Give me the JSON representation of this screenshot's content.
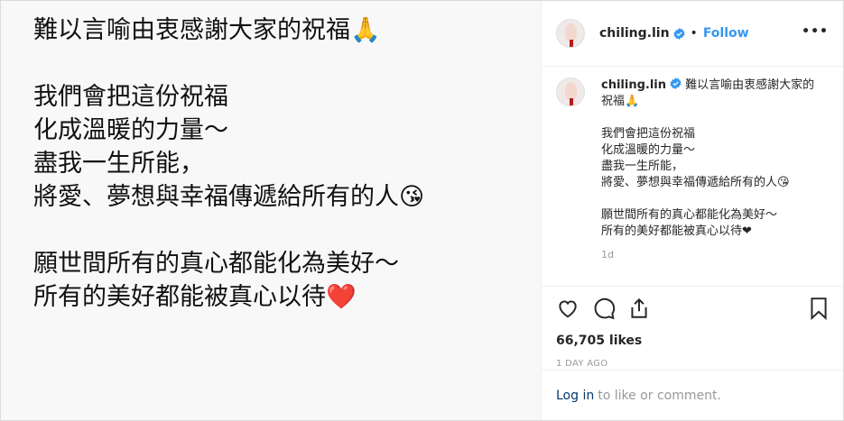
{
  "post_image": {
    "lines": [
      "難以言喻由衷感謝大家的祝福🙏",
      "",
      "我們會把這份祝福",
      "化成溫暖的力量～",
      "盡我一生所能，",
      "將愛、夢想與幸福傳遞給所有的人😘",
      "",
      "願世間所有的真心都能化為美好～",
      "所有的美好都能被真心以待❤️"
    ]
  },
  "header": {
    "username": "chiling.lin",
    "separator": "•",
    "follow_label": "Follow",
    "more_label": "•••"
  },
  "caption": {
    "username": "chiling.lin",
    "first_line": "難以言喻由衷感謝大家的",
    "lines": [
      "祝福🙏",
      "",
      "我們會把這份祝福",
      "化成溫暖的力量～",
      "盡我一生所能，",
      "將愛、夢想與幸福傳遞給所有的人😘",
      "",
      "願世間所有的真心都能化為美好～",
      "所有的美好都能被真心以待❤"
    ],
    "time": "1d"
  },
  "actions": {
    "likes": "66,705 likes",
    "posted_ago": "1 DAY AGO"
  },
  "login": {
    "link_label": "Log in",
    "rest_text": "to like or comment."
  },
  "colors": {
    "accent": "#3897f0",
    "verified": "#3897f0",
    "border": "#dbdbdb",
    "muted": "#999999",
    "text": "#262626"
  }
}
